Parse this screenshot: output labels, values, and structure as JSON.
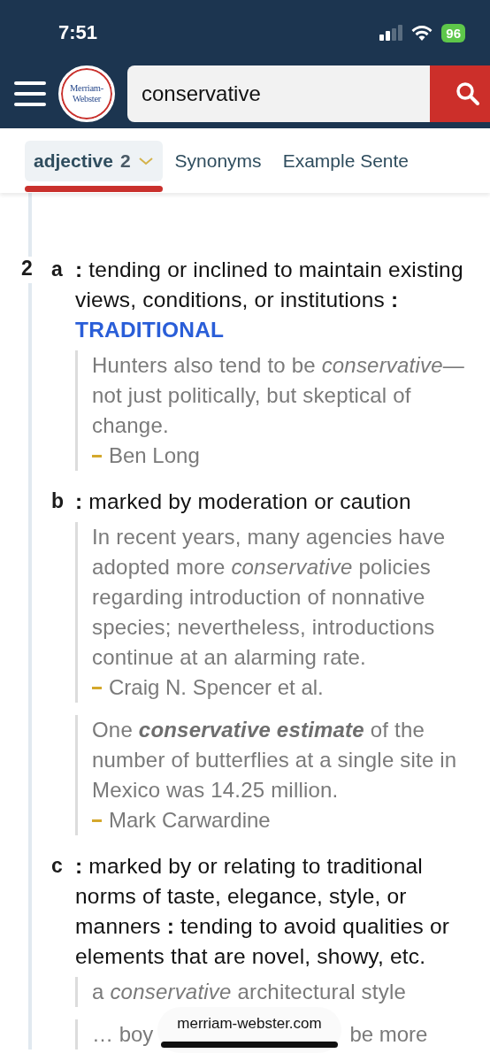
{
  "status_bar": {
    "time": "7:51",
    "battery": "96"
  },
  "header": {
    "logo": [
      "Merriam-",
      "Webster"
    ],
    "search": {
      "value": "conservative"
    }
  },
  "tabs": [
    {
      "label": "adjective",
      "count": "2",
      "selected": true
    },
    {
      "label": "Synonyms",
      "selected": false
    },
    {
      "label": "Example Sente",
      "selected": false
    }
  ],
  "entry": {
    "number": "2",
    "senses": [
      {
        "letter": "a",
        "definitions": [
          "**:** tending or inclined to maintain existing views, conditions, or institutions **:**"
        ],
        "xref": "TRADITIONAL",
        "examples": [
          {
            "text": "Hunters also tend to be *conservative*—not just politically, but skeptical of change.",
            "author": "Ben Long"
          }
        ]
      },
      {
        "letter": "b",
        "definitions": [
          "**:** marked by moderation or caution"
        ],
        "examples": [
          {
            "text": "In recent years, many agencies have adopted more *conservative* policies regarding introduction of nonnative species; nevertheless, introductions continue at an alarming rate.",
            "author": "Craig N. Spencer et al."
          },
          {
            "text": "One **conservative estimate** of the number of butterflies at a single site in Mexico was 14.25 million.",
            "author": "Mark Carwardine"
          }
        ]
      },
      {
        "letter": "c",
        "definitions": [
          "**:** marked by or relating to traditional norms of taste, elegance, style, or manners **:** tending to avoid qualities or elements that are novel, showy, etc."
        ],
        "examples": [
          {
            "text": "a *conservative* architectural style"
          },
          {
            "text": "… boy",
            "text_after": "be more"
          }
        ]
      }
    ]
  },
  "url_pill": {
    "label": "merriam-webster.com"
  }
}
